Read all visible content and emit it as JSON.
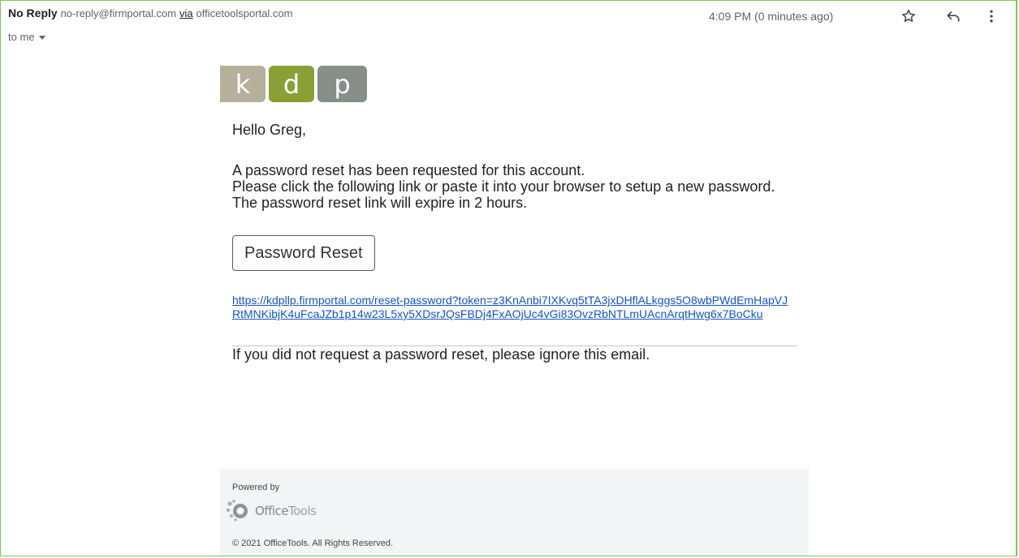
{
  "header": {
    "sender_name": "No Reply",
    "sender_email": "no-reply@firmportal.com",
    "via_label": "via",
    "via_domain": "officetoolsportal.com",
    "recipient": "to me",
    "timestamp": "4:09 PM (0 minutes ago)",
    "icons": [
      "star-icon",
      "reply-icon",
      "more-vert-icon"
    ]
  },
  "logo": {
    "letters": [
      "k",
      "d",
      "p"
    ],
    "colors": [
      "#b5b09b",
      "#8aa035",
      "#869089"
    ]
  },
  "body": {
    "greeting": "Hello Greg,",
    "line1": "A password reset has been requested for this account.",
    "line2": "Please click the following link or paste it into your browser to setup a new password.",
    "line3": "The password reset link will expire in 2 hours.",
    "button_label": "Password Reset",
    "reset_url": "https://kdpllp.firmportal.com/reset-password?token=z3KnAnbi7IXKvq5tTA3jxDHflALkggs5O8wbPWdEmHapVJRtMNKibjK4uFcaJZb1p14w23L5xy5XDsrJQsFBDj4FxAOjUc4vGi83OvzRbNTLmUAcnArqtHwg6x7BoCku",
    "ignore_note": "If you did not request a password reset, please ignore this email."
  },
  "footer": {
    "powered_by": "Powered by",
    "brand_office": "Office",
    "brand_tools": "Tools",
    "copyright": "© 2021 OfficeTools. All Rights Reserved."
  },
  "colors": {
    "frame_border": "#7fc94f",
    "link": "#1155cc",
    "footer_bg": "#f3f4f6"
  }
}
